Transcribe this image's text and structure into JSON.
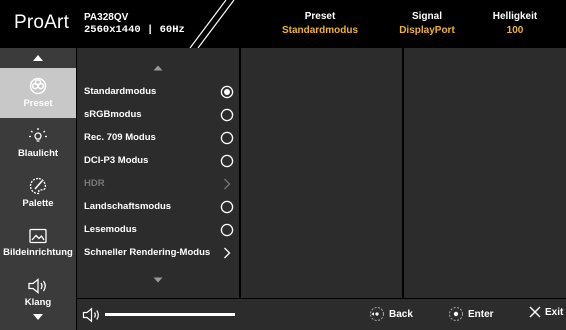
{
  "header": {
    "brand": "ProArt",
    "model": "PA328QV",
    "resolution": "2560x1440",
    "refresh": "60Hz",
    "preset_label": "Preset",
    "preset_value": "Standardmodus",
    "signal_label": "Signal",
    "signal_value": "DisplayPort",
    "brightness_label": "Helligkeit",
    "brightness_value": "100"
  },
  "sidebar": {
    "items": [
      {
        "label": "Preset",
        "icon": "preset-icon",
        "active": true
      },
      {
        "label": "Blaulicht",
        "icon": "bluelight-icon"
      },
      {
        "label": "Palette",
        "icon": "palette-icon"
      },
      {
        "label": "Bildeinrichtung",
        "icon": "image-setup-icon"
      },
      {
        "label": "Klang",
        "icon": "speaker-icon"
      }
    ]
  },
  "list": {
    "items": [
      {
        "label": "Standardmodus",
        "control": "radio-selected"
      },
      {
        "label": "sRGBmodus",
        "control": "radio"
      },
      {
        "label": "Rec. 709 Modus",
        "control": "radio"
      },
      {
        "label": "DCI-P3 Modus",
        "control": "radio"
      },
      {
        "label": "HDR",
        "control": "submenu",
        "disabled": true
      },
      {
        "label": "Landschaftsmodus",
        "control": "radio"
      },
      {
        "label": "Lesemodus",
        "control": "radio"
      },
      {
        "label": "Schneller Rendering-Modus",
        "control": "submenu"
      }
    ]
  },
  "footer": {
    "volume_level": 0.76,
    "back_label": "Back",
    "enter_label": "Enter",
    "exit_label": "Exit"
  },
  "colors": {
    "accent": "#f0b429",
    "panel": "#2c2c2c",
    "sidebar": "#3b3b3b",
    "sidebar_active": "#c8c8c8",
    "disabled_text": "#777777"
  }
}
